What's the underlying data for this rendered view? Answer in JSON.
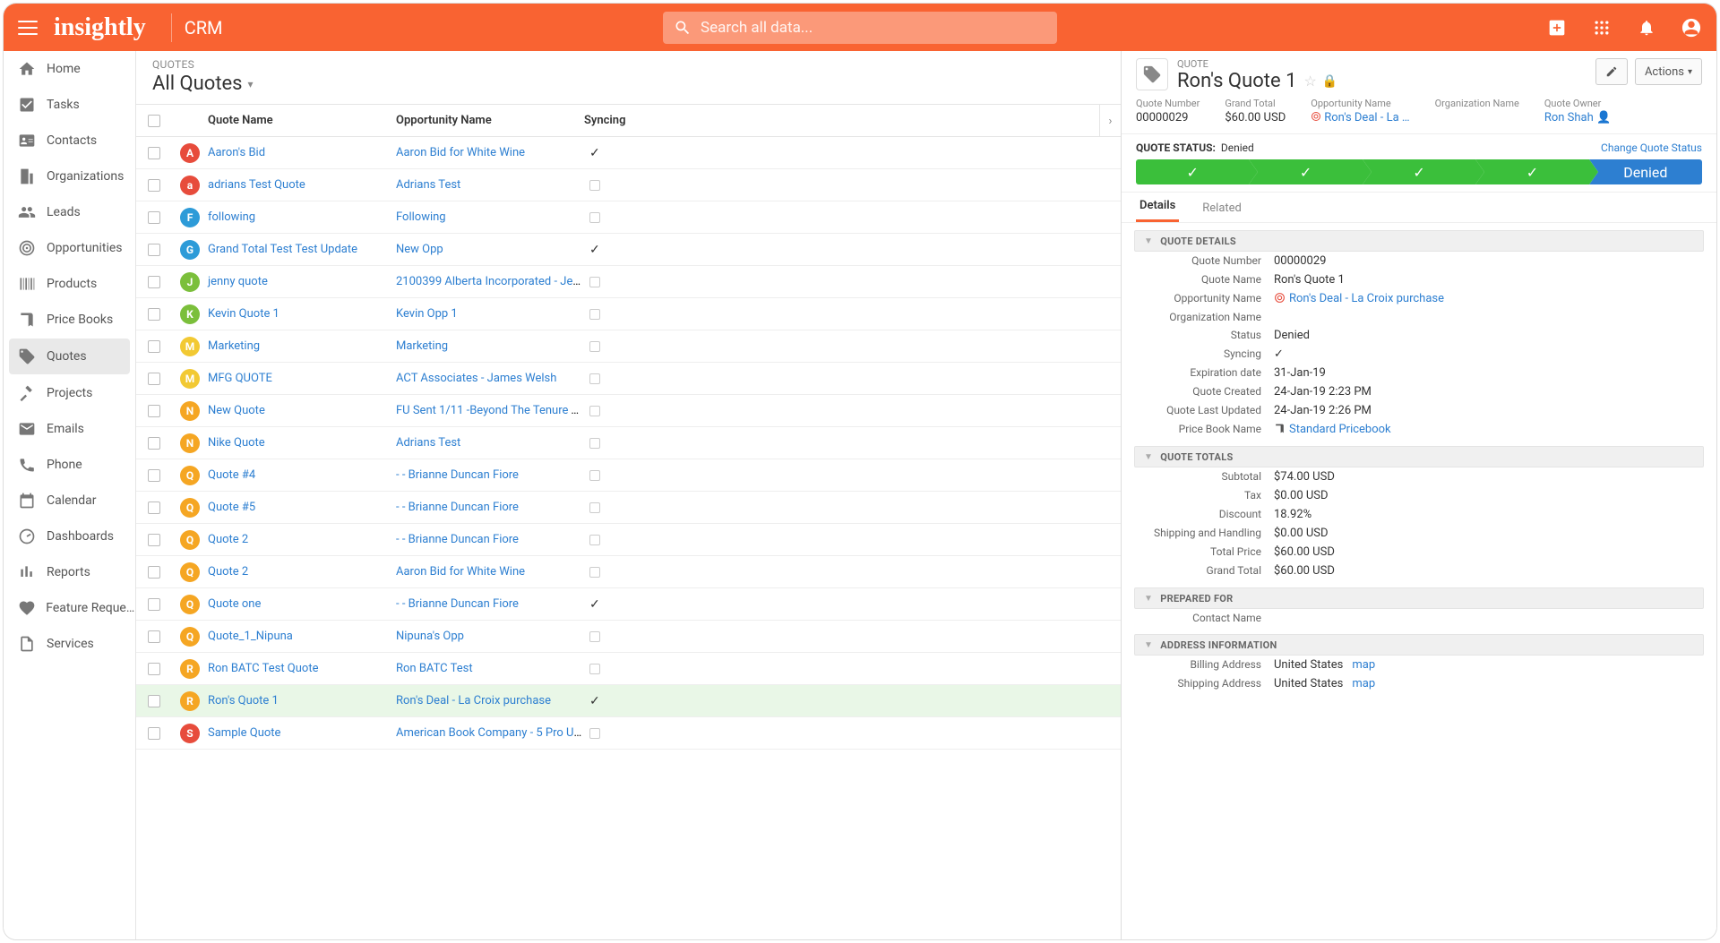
{
  "topbar": {
    "logo": "insightly",
    "product": "CRM",
    "search_placeholder": "Search all data..."
  },
  "nav": [
    {
      "label": "Home",
      "icon": "home"
    },
    {
      "label": "Tasks",
      "icon": "check"
    },
    {
      "label": "Contacts",
      "icon": "id"
    },
    {
      "label": "Organizations",
      "icon": "bldg"
    },
    {
      "label": "Leads",
      "icon": "people"
    },
    {
      "label": "Opportunities",
      "icon": "target"
    },
    {
      "label": "Products",
      "icon": "barcode"
    },
    {
      "label": "Price Books",
      "icon": "book"
    },
    {
      "label": "Quotes",
      "icon": "tag",
      "selected": true
    },
    {
      "label": "Projects",
      "icon": "hammer"
    },
    {
      "label": "Emails",
      "icon": "mail"
    },
    {
      "label": "Phone",
      "icon": "phone"
    },
    {
      "label": "Calendar",
      "icon": "cal"
    },
    {
      "label": "Dashboards",
      "icon": "dash"
    },
    {
      "label": "Reports",
      "icon": "bars"
    },
    {
      "label": "Feature Reque …",
      "icon": "heart"
    },
    {
      "label": "Services",
      "icon": "doc"
    }
  ],
  "list": {
    "crumb": "QUOTES",
    "title": "All Quotes",
    "columns": {
      "name": "Quote Name",
      "opp": "Opportunity Name",
      "sync": "Syncing"
    },
    "rows": [
      {
        "letter": "A",
        "color": "#e74c3c",
        "name": "Aaron's Bid",
        "opp": "Aaron Bid for White Wine",
        "sync": true
      },
      {
        "letter": "a",
        "color": "#e74c3c",
        "name": "adrians Test Quote",
        "opp": "Adrians Test",
        "sync": false
      },
      {
        "letter": "F",
        "color": "#2d9bd8",
        "name": "following",
        "opp": "Following",
        "sync": false
      },
      {
        "letter": "G",
        "color": "#2d9bd8",
        "name": "Grand Total Test Test Update",
        "opp": "New Opp",
        "sync": true
      },
      {
        "letter": "J",
        "color": "#7bbf3b",
        "name": "jenny quote",
        "opp": "2100399 Alberta Incorporated - Jeff …",
        "sync": false
      },
      {
        "letter": "K",
        "color": "#7bbf3b",
        "name": "Kevin Quote 1",
        "opp": "Kevin Opp 1",
        "sync": false
      },
      {
        "letter": "M",
        "color": "#f2c933",
        "name": "Marketing",
        "opp": "Marketing",
        "sync": false
      },
      {
        "letter": "M",
        "color": "#f2c933",
        "name": "MFG QUOTE",
        "opp": "ACT Associates - James Welsh",
        "sync": false
      },
      {
        "letter": "N",
        "color": "#f5a623",
        "name": "New Quote",
        "opp": "FU Sent 1/11 -Beyond The Tenure Tra…",
        "sync": false
      },
      {
        "letter": "N",
        "color": "#f5a623",
        "name": "Nike Quote",
        "opp": "Adrians Test",
        "sync": false
      },
      {
        "letter": "Q",
        "color": "#f5a623",
        "name": "Quote #4",
        "opp": "- - Brianne Duncan Fiore",
        "sync": false
      },
      {
        "letter": "Q",
        "color": "#f5a623",
        "name": "Quote #5",
        "opp": "- - Brianne Duncan Fiore",
        "sync": false
      },
      {
        "letter": "Q",
        "color": "#f5a623",
        "name": "Quote 2",
        "opp": "- - Brianne Duncan Fiore",
        "sync": false
      },
      {
        "letter": "Q",
        "color": "#f5a623",
        "name": "Quote 2",
        "opp": "Aaron Bid for White Wine",
        "sync": false
      },
      {
        "letter": "Q",
        "color": "#f5a623",
        "name": "Quote one",
        "opp": "- - Brianne Duncan Fiore",
        "sync": true
      },
      {
        "letter": "Q",
        "color": "#f5a623",
        "name": "Quote_1_Nipuna",
        "opp": "Nipuna's Opp",
        "sync": false
      },
      {
        "letter": "R",
        "color": "#f5a623",
        "name": "Ron BATC Test Quote",
        "opp": "Ron BATC Test",
        "sync": false
      },
      {
        "letter": "R",
        "color": "#f5a623",
        "name": "Ron's Quote 1",
        "opp": "Ron's Deal - La Croix purchase",
        "sync": true,
        "selected": true
      },
      {
        "letter": "S",
        "color": "#e74c3c",
        "name": "Sample Quote",
        "opp": "American Book Company - 5 Pro Use…",
        "sync": false
      }
    ]
  },
  "detail": {
    "crumb": "QUOTE",
    "title": "Ron's Quote 1",
    "actions_label": "Actions",
    "summary": [
      {
        "lbl": "Quote Number",
        "val": "00000029"
      },
      {
        "lbl": "Grand Total",
        "val": "$60.00 USD"
      },
      {
        "lbl": "Opportunity Name",
        "val": "Ron's Deal - La …",
        "link": true,
        "icon": "target"
      },
      {
        "lbl": "Organization Name",
        "val": " "
      },
      {
        "lbl": "Quote Owner",
        "val": "Ron Shah",
        "link": true,
        "person": true
      }
    ],
    "status_label": "QUOTE STATUS:",
    "status_value": "Denied",
    "change_status": "Change Quote Status",
    "pipeline_final": "Denied",
    "tabs": {
      "details": "Details",
      "related": "Related"
    },
    "sections": {
      "quote_details": {
        "title": "QUOTE DETAILS",
        "rows": [
          {
            "k": "Quote Number",
            "v": "00000029"
          },
          {
            "k": "Quote Name",
            "v": "Ron's Quote 1"
          },
          {
            "k": "Opportunity Name",
            "v": "Ron's Deal - La Croix purchase",
            "link": true,
            "icon": "target"
          },
          {
            "k": "Organization Name",
            "v": ""
          },
          {
            "k": "Status",
            "v": "Denied"
          },
          {
            "k": "Syncing",
            "v": "✓"
          },
          {
            "k": "Expiration date",
            "v": "31-Jan-19"
          },
          {
            "k": "Quote Created",
            "v": "24-Jan-19 2:23 PM"
          },
          {
            "k": "Quote Last Updated",
            "v": "24-Jan-19 2:26 PM"
          },
          {
            "k": "Price Book Name",
            "v": "Standard Pricebook",
            "link": true,
            "icon": "book"
          }
        ]
      },
      "quote_totals": {
        "title": "QUOTE TOTALS",
        "rows": [
          {
            "k": "Subtotal",
            "v": "$74.00 USD"
          },
          {
            "k": "Tax",
            "v": "$0.00 USD"
          },
          {
            "k": "Discount",
            "v": "18.92%"
          },
          {
            "k": "Shipping and Handling",
            "v": "$0.00 USD"
          },
          {
            "k": "Total Price",
            "v": "$60.00 USD"
          },
          {
            "k": "Grand Total",
            "v": "$60.00 USD"
          }
        ]
      },
      "prepared_for": {
        "title": "PREPARED FOR",
        "rows": [
          {
            "k": "Contact Name",
            "v": ""
          }
        ]
      },
      "address": {
        "title": "ADDRESS INFORMATION",
        "rows": [
          {
            "k": "Billing Address",
            "v": "United States",
            "map": "map"
          },
          {
            "k": "Shipping Address",
            "v": "United States",
            "map": "map"
          }
        ]
      }
    }
  }
}
